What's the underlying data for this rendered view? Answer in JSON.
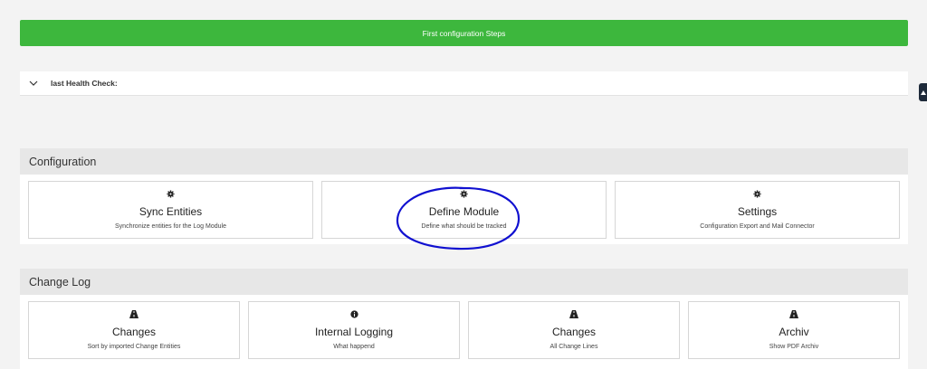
{
  "top_bar": {
    "label": "First configuration Steps"
  },
  "health": {
    "label": "last Health Check:"
  },
  "sections": [
    {
      "title": "Configuration",
      "cards": [
        {
          "icon": "gear-icon",
          "title": "Sync Entities",
          "desc": "Synchronize entities for the Log Module"
        },
        {
          "icon": "gear-icon",
          "title": "Define Module",
          "desc": "Define what should be tracked"
        },
        {
          "icon": "gear-icon",
          "title": "Settings",
          "desc": "Configuration Export and Mail Connector"
        }
      ]
    },
    {
      "title": "Change Log",
      "cards": [
        {
          "icon": "road-icon",
          "title": "Changes",
          "desc": "Sort by imported Change Entities"
        },
        {
          "icon": "info-icon",
          "title": "Internal Logging",
          "desc": "What happend"
        },
        {
          "icon": "road-icon",
          "title": "Changes",
          "desc": "All Change Lines"
        },
        {
          "icon": "road-icon",
          "title": "Archiv",
          "desc": "Show PDF Archiv"
        }
      ]
    }
  ],
  "colors": {
    "accent_green": "#3db73d",
    "annotation_circle": "#1010d0"
  }
}
